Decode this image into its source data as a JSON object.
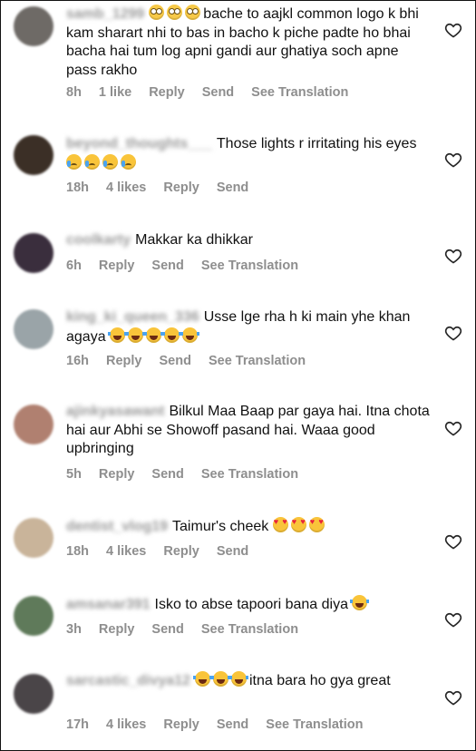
{
  "comments": [
    {
      "username": "samb_1299",
      "emojis_before": [
        "roll",
        "roll",
        "roll"
      ],
      "text": "bache to aajkl common logo k bhi kam sharart nhi to bas in bacho k piche padte ho bhai bacha hai  tum log apni gandi aur ghatiya soch apne pass rakho",
      "emojis_after": [],
      "time": "8h",
      "likes": "1 like",
      "reply": "Reply",
      "send": "Send",
      "translate": "See Translation",
      "avatar": "#6e6a66"
    },
    {
      "username": "beyond_thoughts___",
      "emojis_before": [],
      "text": "Those lights r irritating his eyes",
      "emojis_after": [
        "cry",
        "cry",
        "cry",
        "cry"
      ],
      "time": "18h",
      "likes": "4 likes",
      "reply": "Reply",
      "send": "Send",
      "translate": "",
      "avatar": "#3b2f26"
    },
    {
      "username": "coolkarty",
      "emojis_before": [],
      "text": "Makkar ka dhikkar",
      "emojis_after": [],
      "time": "6h",
      "likes": "",
      "reply": "Reply",
      "send": "Send",
      "translate": "See Translation",
      "avatar": "#3a2e3d"
    },
    {
      "username": "king_ki_queen_336",
      "emojis_before": [],
      "text": "Usse lge rha h ki main yhe khan agaya",
      "emojis_after": [
        "laugh",
        "laugh",
        "laugh",
        "laugh",
        "laugh"
      ],
      "time": "16h",
      "likes": "",
      "reply": "Reply",
      "send": "Send",
      "translate": "See Translation",
      "avatar": "#9aa4a8"
    },
    {
      "username": "ajinkyasawant",
      "emojis_before": [],
      "text": "Bilkul Maa Baap par gaya hai. Itna chota hai aur Abhi se Showoff pasand hai. Waaa good upbringing",
      "emojis_after": [],
      "time": "5h",
      "likes": "",
      "reply": "Reply",
      "send": "Send",
      "translate": "See Translation",
      "avatar": "#b08070"
    },
    {
      "username": "dentist_vlog19",
      "emojis_before": [],
      "text": "Taimur's cheek",
      "emojis_after": [
        "heart",
        "heart",
        "heart"
      ],
      "time": "18h",
      "likes": "4 likes",
      "reply": "Reply",
      "send": "Send",
      "translate": "",
      "avatar": "#c9b49a"
    },
    {
      "username": "amsanar391",
      "emojis_before": [],
      "text": "Isko to abse tapoori bana diya",
      "emojis_after": [
        "laugh"
      ],
      "time": "3h",
      "likes": "",
      "reply": "Reply",
      "send": "Send",
      "translate": "See Translation",
      "avatar": "#5f7a5a"
    },
    {
      "username": "sarcastic_divya12",
      "emojis_before": [
        "laugh",
        "laugh",
        "laugh"
      ],
      "text": "itna bara ho gya great",
      "emojis_after": [],
      "time": "17h",
      "likes": "4 likes",
      "reply": "Reply",
      "send": "Send",
      "translate": "See Translation",
      "avatar": "#4a4548"
    }
  ]
}
